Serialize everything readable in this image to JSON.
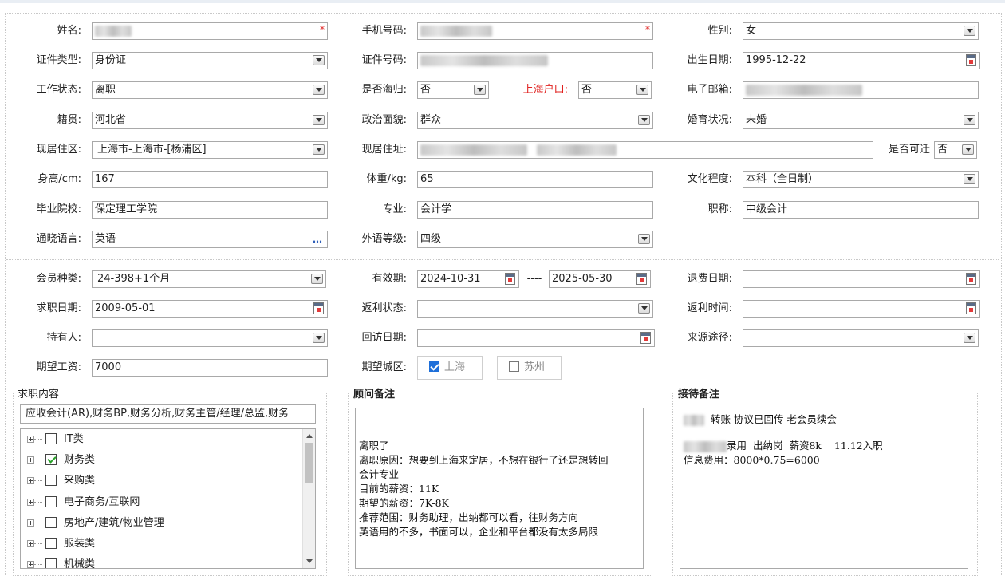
{
  "form": {
    "name_label": "姓名:",
    "phone_label": "手机号码:",
    "gender_label": "性别:",
    "gender_value": "女",
    "idtype_label": "证件类型:",
    "idtype_value": "身份证",
    "idno_label": "证件号码:",
    "birth_label": "出生日期:",
    "birth_value": "1995-12-22",
    "workstatus_label": "工作状态:",
    "workstatus_value": "离职",
    "returnee_label": "是否海归:",
    "returnee_value": "否",
    "shhukou_label": "上海户口:",
    "shhukou_value": "否",
    "email_label": "电子邮箱:",
    "native_label": "籍贯:",
    "native_value": "河北省",
    "political_label": "政治面貌:",
    "political_value": "群众",
    "marital_label": "婚育状况:",
    "marital_value": "未婚",
    "residence_label": "现居住区:",
    "residence_value": "上海市-上海市-[杨浦区]",
    "address_label": "现居住址:",
    "relocate_label": "是否可迁",
    "relocate_value": "否",
    "height_label": "身高/cm:",
    "height_value": "167",
    "weight_label": "体重/kg:",
    "weight_value": "65",
    "education_label": "文化程度:",
    "education_value": "本科（全日制）",
    "school_label": "毕业院校:",
    "school_value": "保定理工学院",
    "major_label": "专业:",
    "major_value": "会计学",
    "title_label": "职称:",
    "title_value": "中级会计",
    "language_label": "通晓语言:",
    "language_value": "英语",
    "more_icon": "…",
    "foreignlevel_label": "外语等级:",
    "foreignlevel_value": "四级",
    "required_mark": "*"
  },
  "membership": {
    "type_label": "会员种类:",
    "type_value": "24-398+1个月",
    "valid_label": "有效期:",
    "valid_from": "2024-10-31",
    "valid_sep": "----",
    "valid_to": "2025-05-30",
    "refund_label": "退费日期:",
    "jobdate_label": "求职日期:",
    "jobdate_value": "2009-05-01",
    "rebate_status_label": "返利状态:",
    "rebate_time_label": "返利时间:",
    "holder_label": "持有人:",
    "revisit_label": "回访日期:",
    "source_label": "来源途径:",
    "salary_label": "期望工资:",
    "salary_value": "7000",
    "city_label": "期望城区:",
    "city_options": [
      {
        "label": "上海",
        "checked": true
      },
      {
        "label": "苏州",
        "checked": false
      }
    ]
  },
  "job": {
    "legend": "求职内容",
    "summary": "应收会计(AR),财务BP,财务分析,财务主管/经理/总监,财务",
    "tree": [
      {
        "label": "IT类",
        "checked": false
      },
      {
        "label": "财务类",
        "checked": true
      },
      {
        "label": "采购类",
        "checked": false
      },
      {
        "label": "电子商务/互联网",
        "checked": false
      },
      {
        "label": "房地产/建筑/物业管理",
        "checked": false
      },
      {
        "label": "服装类",
        "checked": false
      },
      {
        "label": "机械类",
        "checked": false
      }
    ]
  },
  "advisor": {
    "legend": "顾问备注",
    "lines": [
      "离职了",
      "离职原因：想要到上海来定居，不想在银行了还是想转回",
      "会计专业",
      "目前的薪资：11K",
      "期望的薪资：7K-8K",
      "推荐范围：财务助理，出纳都可以看，往财务方向",
      "英语用的不多，书面可以，企业和平台都没有太多局限"
    ]
  },
  "reception": {
    "legend": "接待备注",
    "line1": "转账 协议已回传 老会员续会",
    "line2a": "录用",
    "line2b": "出纳岗",
    "line2c": "薪资8k",
    "line2d": "11.12入职",
    "line3": "信息费用：8000*0.75=6000"
  }
}
